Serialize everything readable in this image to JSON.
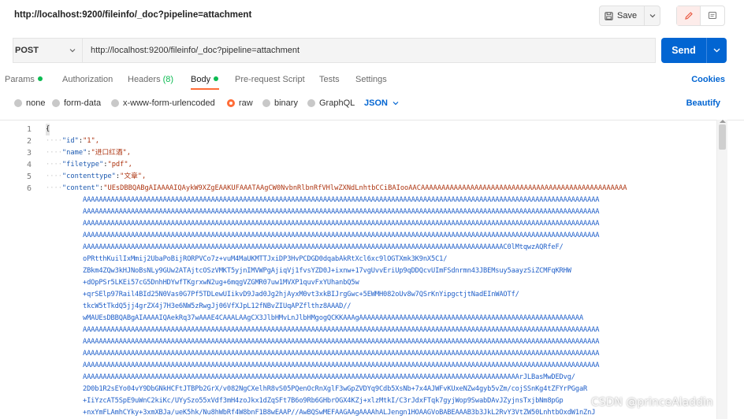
{
  "header": {
    "request_title": "http://localhost:9200/fileinfo/_doc?pipeline=attachment",
    "save_label": "Save"
  },
  "request": {
    "method": "POST",
    "url": "http://localhost:9200/fileinfo/_doc?pipeline=attachment",
    "send_label": "Send"
  },
  "tabs": {
    "params": "Params",
    "authorization": "Authorization",
    "headers": "Headers",
    "headers_count": "(8)",
    "body": "Body",
    "prerequest": "Pre-request Script",
    "tests": "Tests",
    "settings": "Settings",
    "cookies": "Cookies"
  },
  "body_options": {
    "none": "none",
    "form_data": "form-data",
    "urlencoded": "x-www-form-urlencoded",
    "raw": "raw",
    "binary": "binary",
    "graphql": "GraphQL",
    "format": "JSON",
    "beautify": "Beautify"
  },
  "editor": {
    "line_numbers": [
      "1",
      "2",
      "3",
      "4",
      "5",
      "6"
    ],
    "open_brace": "{",
    "fields": [
      {
        "key": "\"id\"",
        "value": "\"1\","
      },
      {
        "key": "\"name\"",
        "value": "\"进口红酒\","
      },
      {
        "key": "\"filetype\"",
        "value": "\"pdf\","
      },
      {
        "key": "\"contenttype\"",
        "value": "\"文章\","
      },
      {
        "key": "\"content\"",
        "value": "\"UEsDBBQABgAIAAAAIQAykW9XZgEAAKUFAAATAAgCW0NvbnRlbnRfVHlwZXNdLnhtbCCiBAIooAACAAAAAAAAAAAAAAAAAAAAAAAAAAAAAAAAAAAAAAAAAAAAAAAAAA"
      }
    ],
    "content_lines": [
      "AAAAAAAAAAAAAAAAAAAAAAAAAAAAAAAAAAAAAAAAAAAAAAAAAAAAAAAAAAAAAAAAAAAAAAAAAAAAAAAAAAAAAAAAAAAAAAAAAAAAAAAAAAAAAAAAAAAAAAAAAAAAAAAAA",
      "AAAAAAAAAAAAAAAAAAAAAAAAAAAAAAAAAAAAAAAAAAAAAAAAAAAAAAAAAAAAAAAAAAAAAAAAAAAAAAAAAAAAAAAAAAAAAAAAAAAAAAAAAAAAAAAAAAAAAAAAAAAAAAAAA",
      "AAAAAAAAAAAAAAAAAAAAAAAAAAAAAAAAAAAAAAAAAAAAAAAAAAAAAAAAAAAAAAAAAAAAAAAAAAAAAAAAAAAAAAAAAAAAAAAAAAAAAAAAAAAAAAAAAAAAAAAAAAAAAAAAA",
      "AAAAAAAAAAAAAAAAAAAAAAAAAAAAAAAAAAAAAAAAAAAAAAAAAAAAAAAAAAAAAAAAAAAAAAAAAAAAAAAAAAAAAAAAAAAAAAAAAAAAAAAAAAAAAAAAAAAAAAAAAAAAAAAAA",
      "AAAAAAAAAAAAAAAAAAAAAAAAAAAAAAAAAAAAAAAAAAAAAAAAAAAAAAAAAAAAAAAAAAAAAAAAAAAAAAAAAAAAAAAAAAAAAAAAAAAAAAAAAC0lMtqwzAQRfeF/",
      "oPRtthKuilIxMmij2UbaPoBijRORPVCo7z+vuM4MaUKMTTJxiDP3HvPCDGD0dqabAkRtXcl6xc9lOGTXmk3K9nX5C1/",
      "ZBkm4ZQw3kHJNoBsNLy9GUw2ATAjtcOSzVMKT5yjnIMVWPgAjiqVj1fvsYZD0J+ixnw+17vgUvvEriUp9qDDQcvUImFSdnrmn43JBEMsuy5aayzSiZCMFqKRHW",
      "+dOpPSr5LKEi57cG5DnhHDYwfTKgrxwN2ug+6mqgVZGMR07uw1MVXP1quvFxYUhanbQ5w",
      "+qrSElp97Rail4BId25N0Vas0G7Pf5TDLewUIikvD9Jad0Jg2hjAyxM0vt3xkBIJrgGwc+5EWMH082oUv8w7QSrKnYipgctjtNadEInWAOTf/",
      "tkcW5tTkdQ5jj4grZX4j7H3e6NW5zRwgJj06VfXJpL12fNBvZIUqAPZflthz8AAAD//",
      "wMAUEsDBBQABgAIAAAAIQAekRq37wAAAE4CAAALAAgCX3JlbHMvLnJlbHMgogQCKKAAAgAAAAAAAAAAAAAAAAAAAAAAAAAAAAAAAAAAAAAAAAAAAAAAAAAAAAAAAA",
      "AAAAAAAAAAAAAAAAAAAAAAAAAAAAAAAAAAAAAAAAAAAAAAAAAAAAAAAAAAAAAAAAAAAAAAAAAAAAAAAAAAAAAAAAAAAAAAAAAAAAAAAAAAAAAAAAAAAAAAAAAAAAAAAAA",
      "AAAAAAAAAAAAAAAAAAAAAAAAAAAAAAAAAAAAAAAAAAAAAAAAAAAAAAAAAAAAAAAAAAAAAAAAAAAAAAAAAAAAAAAAAAAAAAAAAAAAAAAAAAAAAAAAAAAAAAAAAAAAAAAAA",
      "AAAAAAAAAAAAAAAAAAAAAAAAAAAAAAAAAAAAAAAAAAAAAAAAAAAAAAAAAAAAAAAAAAAAAAAAAAAAAAAAAAAAAAAAAAAAAAAAAAAAAAAAAAAAAAAAAAAAAAAAAAAAAAAAA",
      "AAAAAAAAAAAAAAAAAAAAAAAAAAAAAAAAAAAAAAAAAAAAAAAAAAAAAAAAAAAAAAAAAAAAAAAAAAAAAAAAAAAAAAAAAAAAAAAAAAAAAAAAAAAAAAAAAAAAAAAAAAAAAAAAA",
      "AAAAAAAAAAAAAAAAAAAAAAAAAAAAAAAAAAAAAAAAAAAAAAAAAAAAAAAAAAAAAAAAAAAAAAAAAAAAAAAAAAAAAAAAAAAAAAAAAAAAAAAAAAAAArJLBasMwDEDvg/",
      "2D0b1R2sEYo04vY9DbGNkHCFtJTBPb2GrX/v082NgCXelhR8vS05PQenOcRnXglF3wGpZVDYq9Cdb5XsNb+7x4AJWFvKUxeNZw4gyb5vZm/cojSSnKg4tZFYrPGgaR",
      "+IiYzcAT5SpE9uWnC2kiKc/UYySzo55xVdf3mH4zoJkx1dZqSFt7B6o9Rb6GHbrOGX4KZj+xlzMtkI/C3rJdxFTqk7gyjWop9SwabDAvJZyjnsTxjbNm8pGp",
      "+nxYmFLAmhCYky+3xmXBJa/ueK5hk/Nu8hWbRf4W8bnF1B8wEAAP//AwBQSwMEFAAGAAgAAAAhALJengn1HOAAGVoBABEAAAB3b3JkL2RvY3VtZW50LnhtbOxdW1nZnJ"
    ]
  },
  "watermark": "CSDN @princeAladdin"
}
